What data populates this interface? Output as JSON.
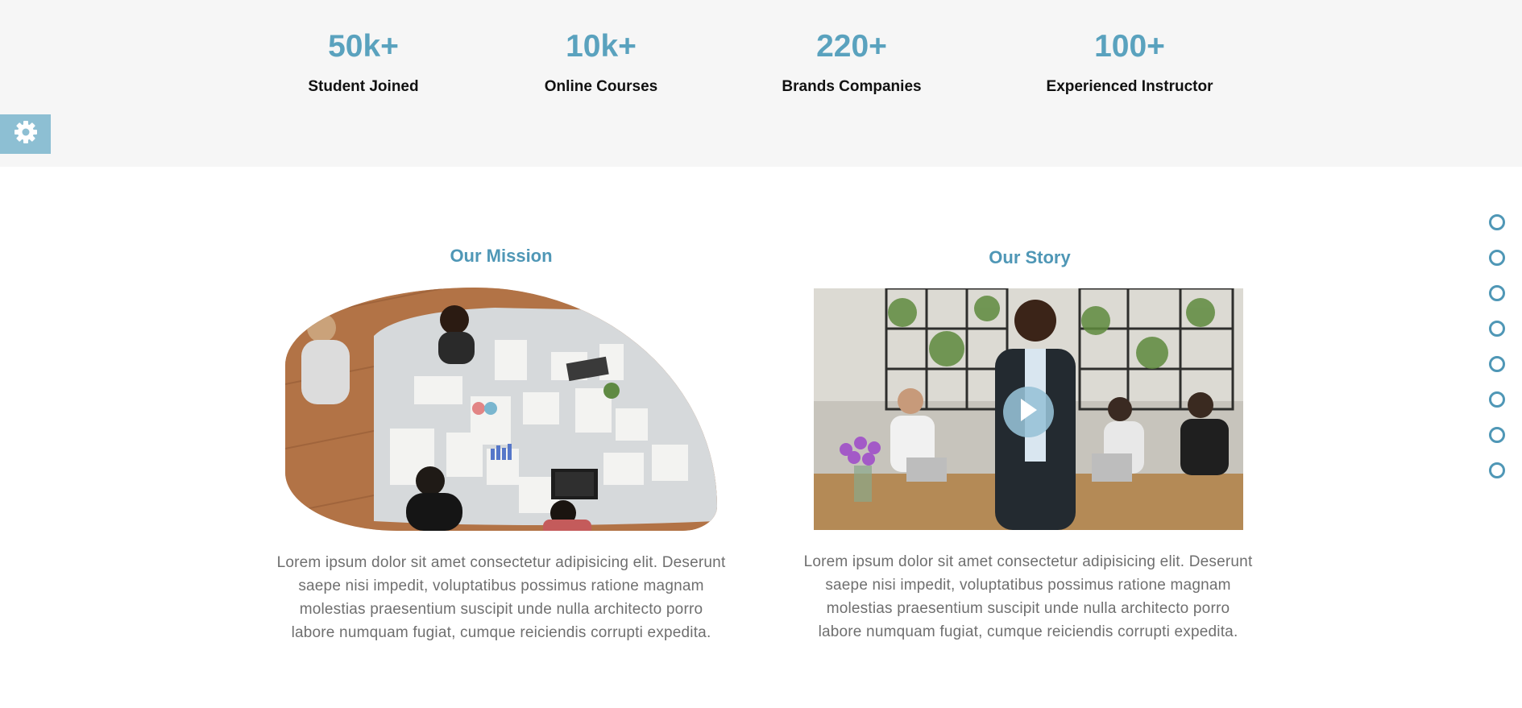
{
  "stats": [
    {
      "value": "50k+",
      "label": "Student Joined"
    },
    {
      "value": "10k+",
      "label": "Online Courses"
    },
    {
      "value": "220+",
      "label": "Brands Companies"
    },
    {
      "value": "100+",
      "label": "Experienced Instructor"
    }
  ],
  "mission": {
    "title": "Our Mission",
    "text": "Lorem ipsum dolor sit amet consectetur adipisicing elit. Deserunt saepe nisi impedit, voluptatibus possimus ratione magnam molestias praesentium suscipit unde nulla architecto porro labore numquam fugiat, cumque reiciendis corrupti expedita."
  },
  "story": {
    "title": "Our Story",
    "text": "Lorem ipsum dolor sit amet consectetur adipisicing elit. Deserunt saepe nisi impedit, voluptatibus possimus ratione magnam molestias praesentium suscipit unde nulla architecto porro labore numquam fugiat, cumque reiciendis corrupti expedita."
  },
  "icons": {
    "settings": "gear-icon",
    "play": "play-icon"
  },
  "colors": {
    "accent": "#4f97b6",
    "stat_value": "#5aa2be",
    "settings_bg": "#8dbfd3",
    "band_bg": "#f6f6f6",
    "body_text": "#6f6f6f"
  },
  "page_dots": {
    "count": 8
  }
}
